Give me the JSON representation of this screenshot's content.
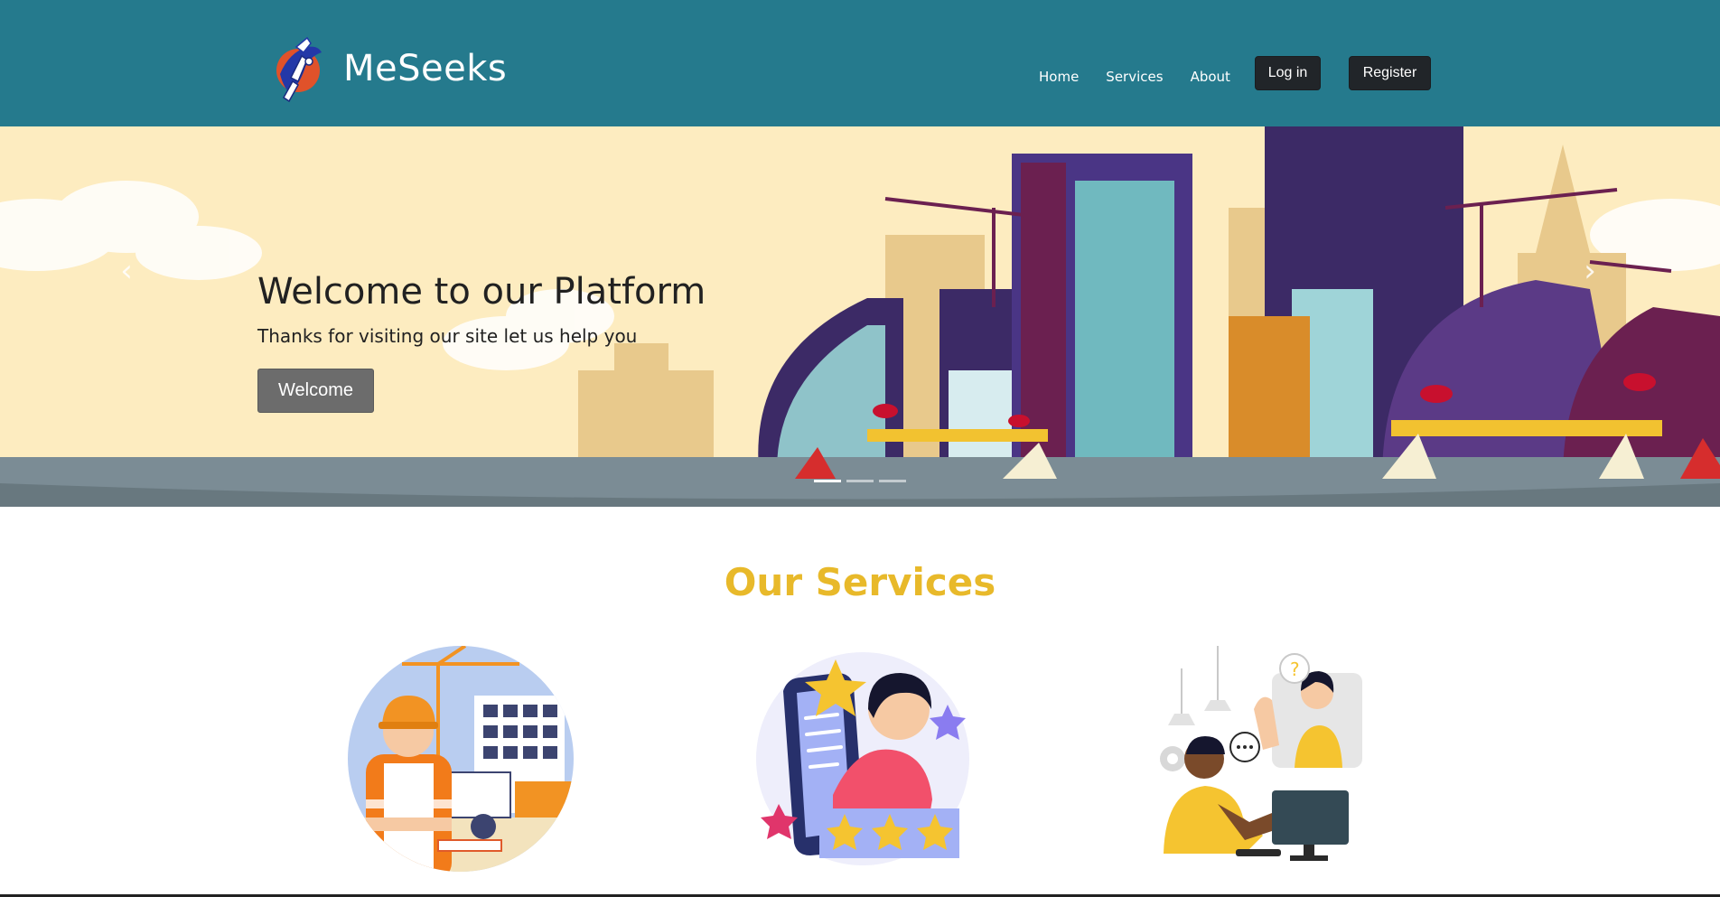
{
  "navbar": {
    "brand_name": "MeSeeks",
    "links": [
      "Home",
      "Services",
      "About"
    ],
    "login_label": "Log in",
    "register_label": "Register",
    "background_color": "#257a8d"
  },
  "hero": {
    "title": "Welcome to our Platform",
    "subtitle": "Thanks for visiting our site let us help you",
    "button_label": "Welcome",
    "prev_icon": "chevron-left-icon",
    "next_icon": "chevron-right-icon",
    "slides_count": 3,
    "active_slide": 1
  },
  "services": {
    "title": "Our Services",
    "title_color": "#e8b92a",
    "items": [
      {
        "image": "construction-worker-illustration"
      },
      {
        "image": "phone-rating-illustration"
      },
      {
        "image": "customer-support-illustration"
      }
    ]
  }
}
